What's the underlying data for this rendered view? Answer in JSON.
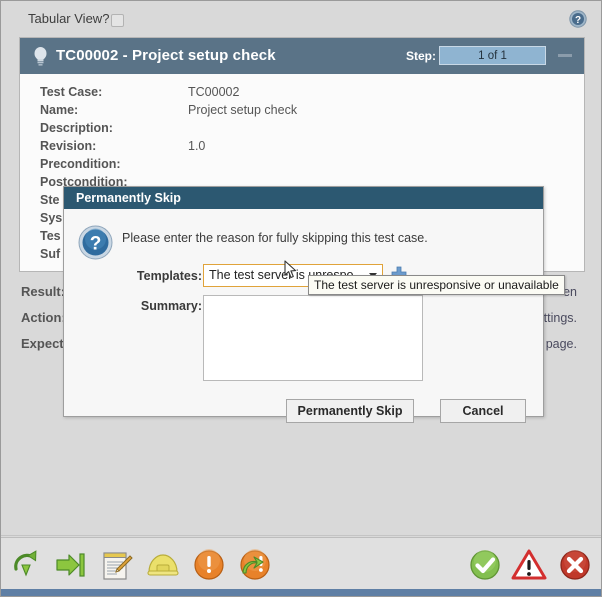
{
  "topbar": {
    "tabular_label": "Tabular View?",
    "tabular_checked": false,
    "help_icon": "help-circle-icon"
  },
  "panel": {
    "title": "TC00002 - Project setup check",
    "bulb_icon": "lightbulb-icon",
    "step_label": "Step:",
    "step_value": "1 of 1",
    "collapse_icon": "minimize-icon",
    "fields": [
      {
        "label": "Test Case:",
        "value": "TC00002"
      },
      {
        "label": "Name:",
        "value": "Project setup check"
      },
      {
        "label": "Description:",
        "value": ""
      },
      {
        "label": "Revision:",
        "value": "1.0"
      },
      {
        "label": "Precondition:",
        "value": ""
      },
      {
        "label": "Postcondition:",
        "value": ""
      },
      {
        "label": "Ste",
        "value": ""
      },
      {
        "label": "Sys",
        "value": ""
      },
      {
        "label": "Tes",
        "value": ""
      },
      {
        "label": "Suf",
        "value": ""
      }
    ]
  },
  "result_rows": [
    {
      "label": "Result:",
      "text": "en"
    },
    {
      "label": "Action:",
      "text": "ettings."
    },
    {
      "label": "Expect",
      "text": "n page."
    }
  ],
  "dialog": {
    "title": "Permanently Skip",
    "question_icon": "question-mark-icon",
    "message": "Please enter the reason for fully skipping this test case.",
    "templates_label": "Templates:",
    "templates_value": "The test server is unrespo ...",
    "templates_arrow_icon": "chevron-down-icon",
    "add_template_icon": "plus-icon",
    "summary_label": "Summary:",
    "summary_value": "",
    "summary_placeholder": "",
    "skip_button": "Permanently Skip",
    "cancel_button": "Cancel"
  },
  "tooltip": {
    "text": "The test server is unresponsive or unavailable"
  },
  "toolbar": {
    "left_icons": [
      {
        "name": "rerun-step-icon",
        "title": "Re-run"
      },
      {
        "name": "skip-step-icon",
        "title": "Skip"
      },
      {
        "name": "edit-note-icon",
        "title": "Edit note"
      },
      {
        "name": "blocked-hardhat-icon",
        "title": "Blocked"
      },
      {
        "name": "caution-exclamation-icon",
        "title": "Caution"
      },
      {
        "name": "caution-continue-icon",
        "title": "Caution and continue"
      }
    ],
    "right_icons": [
      {
        "name": "pass-check-icon",
        "title": "Pass"
      },
      {
        "name": "warning-triangle-icon",
        "title": "Warning"
      },
      {
        "name": "fail-cross-icon",
        "title": "Fail"
      }
    ]
  },
  "colors": {
    "panel_header": "#5a7387",
    "dialog_header": "#2c5871",
    "step_box": "#8fb4d1",
    "accent_orange": "#e0a33a",
    "status_bar": "#5f7fa5",
    "pass_green": "#7cb342",
    "fail_red": "#c62828",
    "warning_red": "#d32f2f"
  }
}
